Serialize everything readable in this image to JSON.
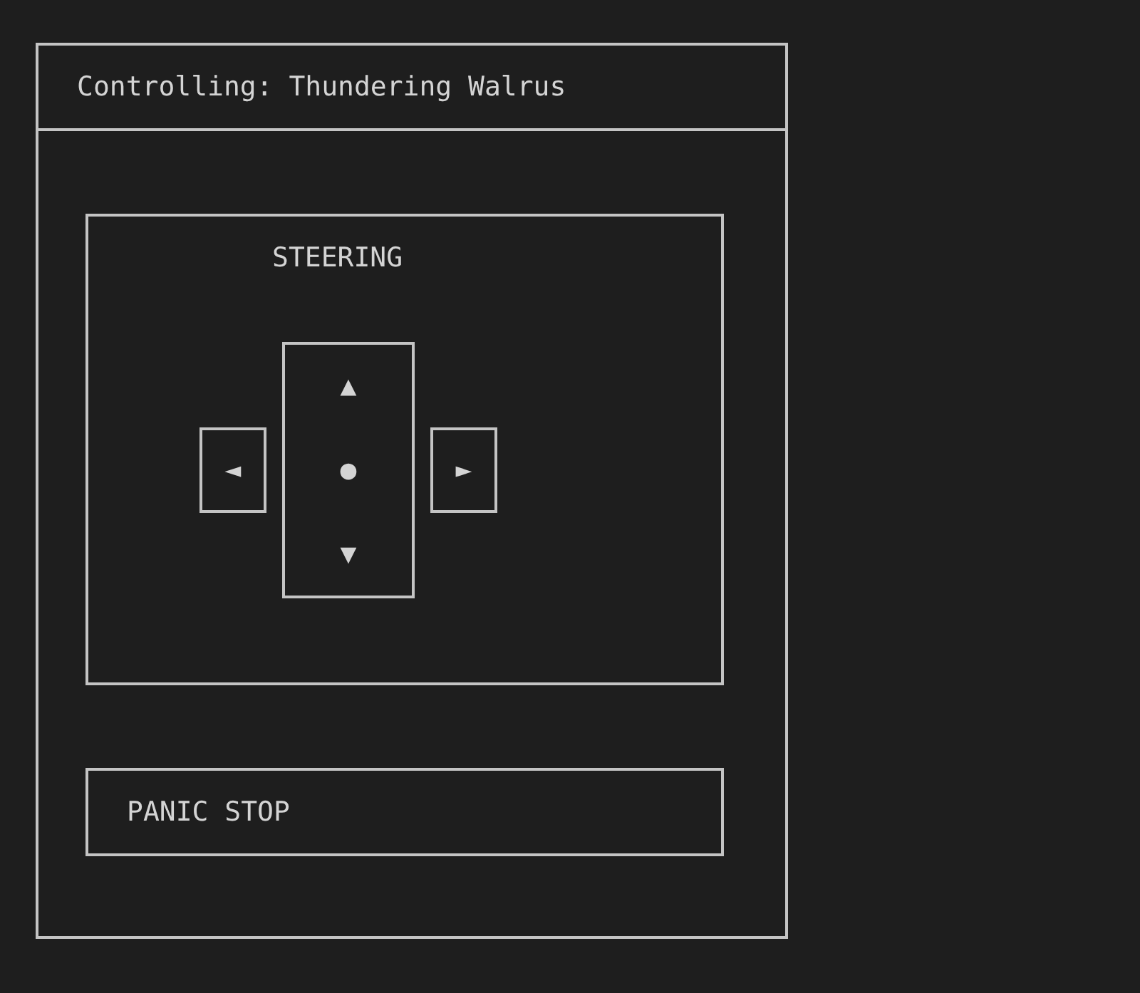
{
  "header": {
    "title": "Controlling: Thundering Walrus"
  },
  "steering": {
    "title": "STEERING",
    "dpad": {
      "up": "▲",
      "center": "●",
      "down": "▼",
      "left": "◄",
      "right": "►"
    }
  },
  "panic_button": {
    "label": "PANIC STOP"
  }
}
